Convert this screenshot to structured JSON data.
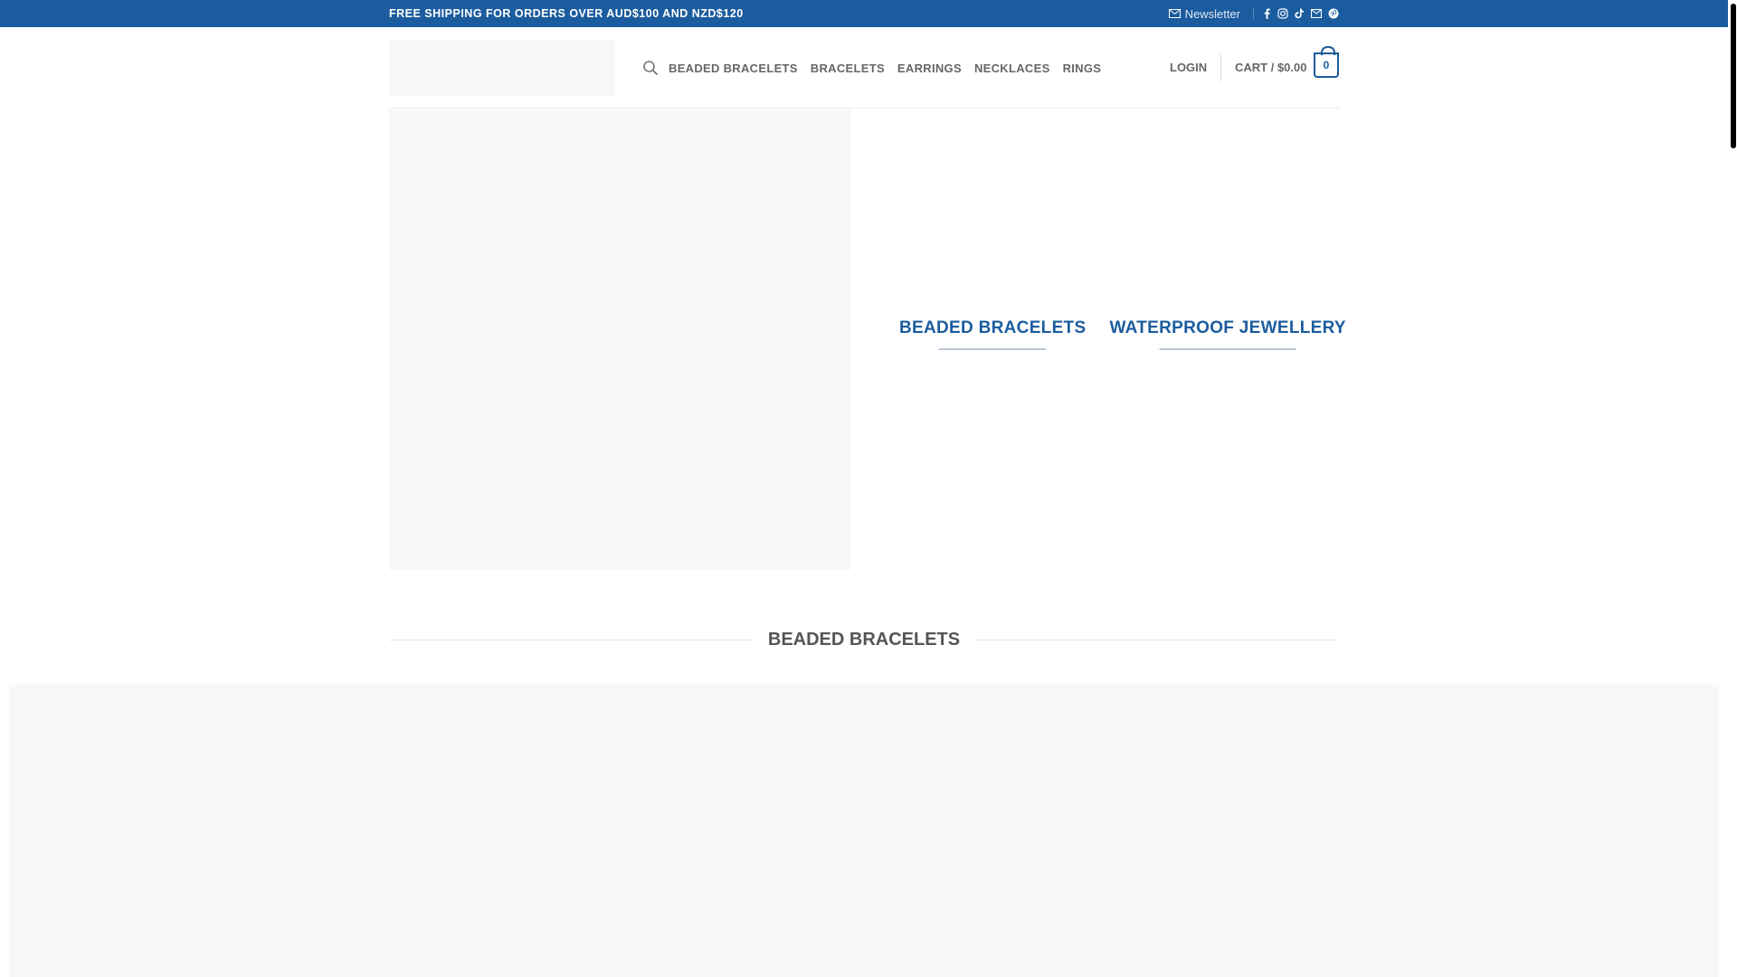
{
  "topbar": {
    "shipping_text": "FREE SHIPPING FOR ORDERS OVER AUD$100 AND NZD$120",
    "newsletter_label": "Newsletter",
    "social_icons": [
      "facebook-icon",
      "instagram-icon",
      "tiktok-icon",
      "email-icon",
      "pinterest-icon"
    ]
  },
  "header": {
    "nav": [
      "BEADED BRACELETS",
      "BRACELETS",
      "EARRINGS",
      "NECKLACES",
      "RINGS"
    ],
    "login_label": "LOGIN",
    "cart_label": "CART / $0.00",
    "cart_count": "0"
  },
  "hero": {
    "links": [
      "BEADED BRACELETS",
      "WATERPROOF JEWELLERY"
    ]
  },
  "section": {
    "title": "BEADED BRACELETS"
  },
  "colors": {
    "brand": "#1b5c9e",
    "topbar_bg": "#1b5c9e",
    "placeholder_bg": "#f8f8f8"
  }
}
